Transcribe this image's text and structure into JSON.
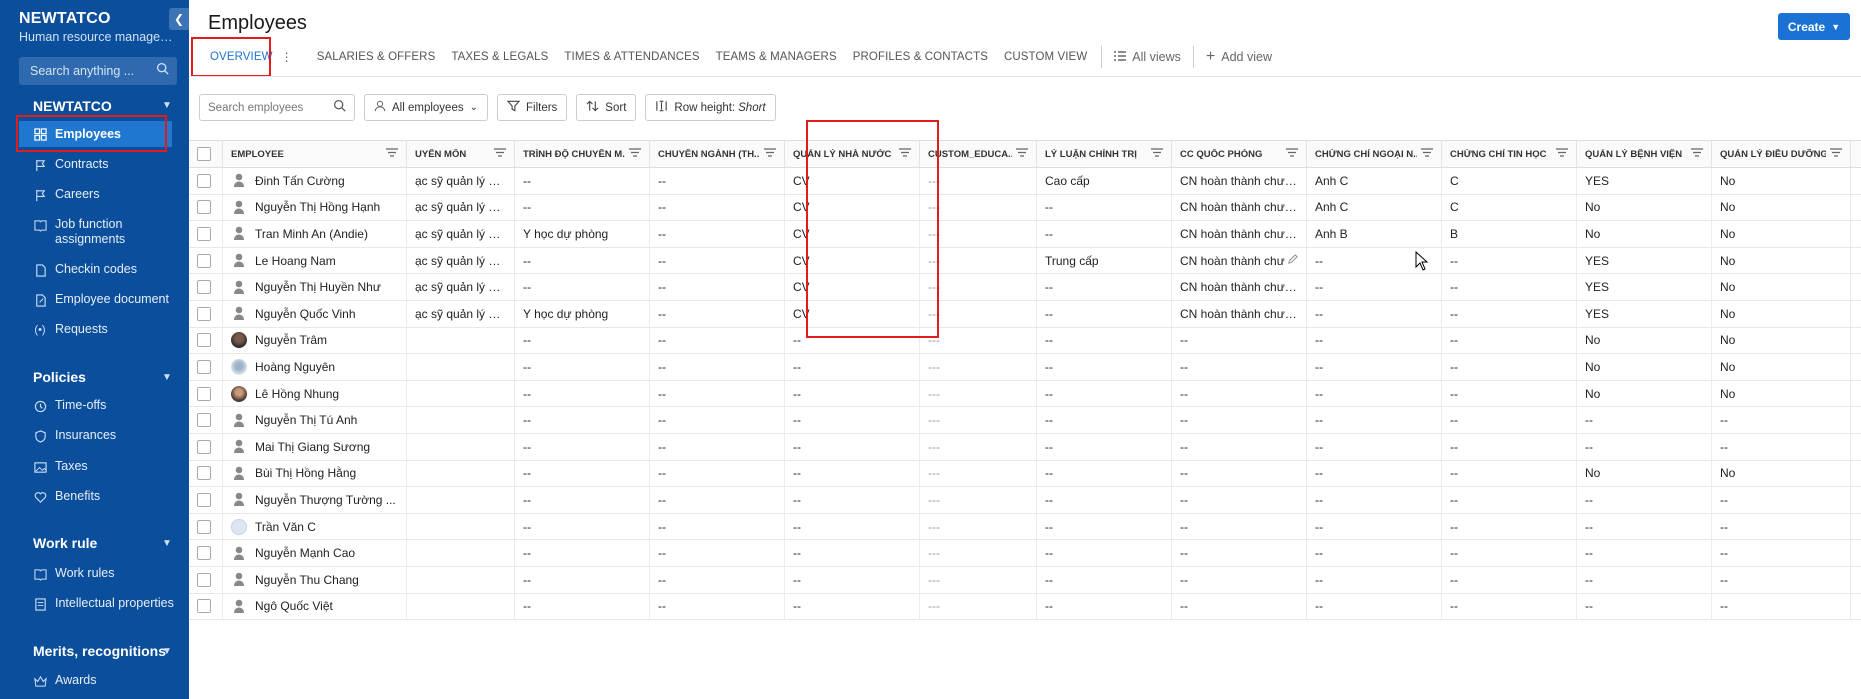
{
  "sidebar": {
    "brand": "NEWTATCO",
    "brand_sub": "Human resource manageme...",
    "search_placeholder": "Search anything ...",
    "sections": {
      "org": "NEWTATCO",
      "policies": "Policies",
      "work_rule": "Work rule",
      "merits": "Merits, recognitions"
    },
    "items": {
      "employees": "Employees",
      "contracts": "Contracts",
      "careers": "Careers",
      "job_function": "Job function assignments",
      "checkin": "Checkin codes",
      "employee_document": "Employee document",
      "requests": "Requests",
      "timeoffs": "Time-offs",
      "insurances": "Insurances",
      "taxes": "Taxes",
      "benefits": "Benefits",
      "work_rules": "Work rules",
      "intellectual": "Intellectual properties",
      "awards": "Awards"
    }
  },
  "header": {
    "title": "Employees",
    "create": "Create"
  },
  "tabs": {
    "overview": "OVERVIEW",
    "salaries": "SALARIES & OFFERS",
    "taxes": "TAXES & LEGALS",
    "times": "TIMES & ATTENDANCES",
    "teams": "TEAMS & MANAGERS",
    "profiles": "PROFILES & CONTACTS",
    "custom": "CUSTOM VIEW",
    "all_views": "All views",
    "add_view": "Add view"
  },
  "toolbar": {
    "search_placeholder": "Search employees",
    "all_employees": "All employees",
    "filters": "Filters",
    "sort": "Sort",
    "row_height_label": "Row height:",
    "row_height_value": "Short"
  },
  "columns": {
    "employee": "EMPLOYEE",
    "chuyen_mon": "UYÊN MÔN",
    "trinh_do": "TRÌNH ĐỘ CHUYÊN M...",
    "chuyen_nganh": "CHUYÊN NGÀNH (TH...",
    "quan_ly_nha_nuoc": "QUẢN LÝ NHÀ NƯỚC",
    "custom_educa": "CUSTOM_EDUCA...",
    "ly_luan": "LÝ LUẬN CHÍNH TRỊ",
    "cc_quoc_phong": "CC QUỐC PHÒNG",
    "ngoai_ngu": "CHỨNG CHỈ NGOẠI N...",
    "tin_hoc": "CHỨNG CHỈ TIN HỌC",
    "benh_vien": "QUẢN LÝ BỆNH VIỆN",
    "dieu_duong": "QUẢN LÝ ĐIỀU DƯỠNG"
  },
  "rows": [
    {
      "name": "Đinh Tấn Cường",
      "chuyen_mon": "ạc sỹ quản lý bệnh...",
      "trinh_do": "--",
      "chuyen_nganh": "--",
      "qlnn": "CV",
      "custom": "---",
      "ly_luan": "Cao cấp",
      "cc": "CN hoàn thành chươ...",
      "nn": "Anh C",
      "th": "C",
      "bv": "YES",
      "dd": "No"
    },
    {
      "name": "Nguyễn Thị Hồng Hạnh",
      "chuyen_mon": "ạc sỹ quản lý bệnh...",
      "trinh_do": "--",
      "chuyen_nganh": "--",
      "qlnn": "CV",
      "custom": "---",
      "ly_luan": "--",
      "cc": "CN hoàn thành chươ...",
      "nn": "Anh C",
      "th": "C",
      "bv": "No",
      "dd": "No"
    },
    {
      "name": "Tran Minh An (Andie)",
      "chuyen_mon": "ạc sỹ quản lý bệnh...",
      "trinh_do": "Y học dự phòng",
      "chuyen_nganh": "--",
      "qlnn": "CV",
      "custom": "---",
      "ly_luan": "--",
      "cc": "CN hoàn thành chươ...",
      "nn": "Anh B",
      "th": "B",
      "bv": "No",
      "dd": "No"
    },
    {
      "name": "Le Hoang Nam",
      "chuyen_mon": "ạc sỹ quản lý bệnh...",
      "trinh_do": "--",
      "chuyen_nganh": "--",
      "qlnn": "CV",
      "custom": "---",
      "ly_luan": "Trung cấp",
      "cc": "CN hoàn thành chư",
      "nn": "--",
      "th": "--",
      "bv": "YES",
      "dd": "No"
    },
    {
      "name": "Nguyễn Thị Huyền Như",
      "chuyen_mon": "ạc sỹ quản lý bệnh...",
      "trinh_do": "--",
      "chuyen_nganh": "--",
      "qlnn": "CV",
      "custom": "---",
      "ly_luan": "--",
      "cc": "CN hoàn thành chươ...",
      "nn": "--",
      "th": "--",
      "bv": "YES",
      "dd": "No"
    },
    {
      "name": "Nguyễn Quốc Vinh",
      "chuyen_mon": "ạc sỹ quản lý bệnh...",
      "trinh_do": "Y học dự phòng",
      "chuyen_nganh": "--",
      "qlnn": "CV",
      "custom": "---",
      "ly_luan": "--",
      "cc": "CN hoàn thành chươ...",
      "nn": "--",
      "th": "--",
      "bv": "YES",
      "dd": "No"
    },
    {
      "name": "Nguyễn Trâm",
      "chuyen_mon": "",
      "trinh_do": "--",
      "chuyen_nganh": "--",
      "qlnn": "--",
      "custom": "---",
      "ly_luan": "--",
      "cc": "--",
      "nn": "--",
      "th": "--",
      "bv": "No",
      "dd": "No"
    },
    {
      "name": "Hoàng Nguyên",
      "chuyen_mon": "",
      "trinh_do": "--",
      "chuyen_nganh": "--",
      "qlnn": "--",
      "custom": "---",
      "ly_luan": "--",
      "cc": "--",
      "nn": "--",
      "th": "--",
      "bv": "No",
      "dd": "No"
    },
    {
      "name": "Lê Hồng Nhung",
      "chuyen_mon": "",
      "trinh_do": "--",
      "chuyen_nganh": "--",
      "qlnn": "--",
      "custom": "---",
      "ly_luan": "--",
      "cc": "--",
      "nn": "--",
      "th": "--",
      "bv": "No",
      "dd": "No"
    },
    {
      "name": "Nguyễn Thị Tú Anh",
      "chuyen_mon": "",
      "trinh_do": "--",
      "chuyen_nganh": "--",
      "qlnn": "--",
      "custom": "---",
      "ly_luan": "--",
      "cc": "--",
      "nn": "--",
      "th": "--",
      "bv": "--",
      "dd": "--"
    },
    {
      "name": "Mai Thị Giang Sương",
      "chuyen_mon": "",
      "trinh_do": "--",
      "chuyen_nganh": "--",
      "qlnn": "--",
      "custom": "---",
      "ly_luan": "--",
      "cc": "--",
      "nn": "--",
      "th": "--",
      "bv": "--",
      "dd": "--"
    },
    {
      "name": "Bùi Thị Hồng Hằng",
      "chuyen_mon": "",
      "trinh_do": "--",
      "chuyen_nganh": "--",
      "qlnn": "--",
      "custom": "---",
      "ly_luan": "--",
      "cc": "--",
      "nn": "--",
      "th": "--",
      "bv": "No",
      "dd": "No"
    },
    {
      "name": "Nguyễn Thượng Tường ...",
      "chuyen_mon": "",
      "trinh_do": "--",
      "chuyen_nganh": "--",
      "qlnn": "--",
      "custom": "---",
      "ly_luan": "--",
      "cc": "--",
      "nn": "--",
      "th": "--",
      "bv": "--",
      "dd": "--"
    },
    {
      "name": "Trần Văn C",
      "chuyen_mon": "",
      "trinh_do": "--",
      "chuyen_nganh": "--",
      "qlnn": "--",
      "custom": "---",
      "ly_luan": "--",
      "cc": "--",
      "nn": "--",
      "th": "--",
      "bv": "--",
      "dd": "--"
    },
    {
      "name": "Nguyễn Mạnh Cao",
      "chuyen_mon": "",
      "trinh_do": "--",
      "chuyen_nganh": "--",
      "qlnn": "--",
      "custom": "---",
      "ly_luan": "--",
      "cc": "--",
      "nn": "--",
      "th": "--",
      "bv": "--",
      "dd": "--"
    },
    {
      "name": "Nguyễn Thu Chang",
      "chuyen_mon": "",
      "trinh_do": "--",
      "chuyen_nganh": "--",
      "qlnn": "--",
      "custom": "---",
      "ly_luan": "--",
      "cc": "--",
      "nn": "--",
      "th": "--",
      "bv": "--",
      "dd": "--"
    },
    {
      "name": "Ngô Quốc Việt",
      "chuyen_mon": "",
      "trinh_do": "--",
      "chuyen_nganh": "--",
      "qlnn": "--",
      "custom": "---",
      "ly_luan": "--",
      "cc": "--",
      "nn": "--",
      "th": "--",
      "bv": "--",
      "dd": "--"
    }
  ],
  "avatars": [
    "person-icon",
    "person-icon",
    "person-icon",
    "person-icon",
    "person-icon",
    "person-icon",
    "photo-dark",
    "photo-light",
    "photo-mixed",
    "person-icon",
    "person-icon",
    "person-icon",
    "person-icon",
    "photo-blank",
    "person-icon",
    "person-icon",
    "person-icon"
  ],
  "colors": {
    "sidebar_bg": "#0b4f9c",
    "accent": "#1a73d4",
    "highlight": "#e21b1b"
  }
}
